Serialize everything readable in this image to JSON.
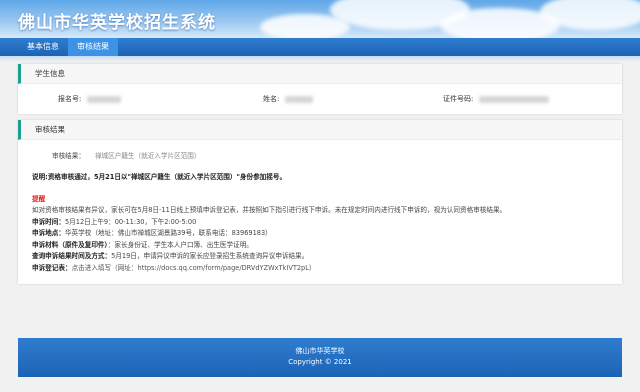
{
  "header": {
    "title": "佛山市华英学校招生系统"
  },
  "nav": {
    "tabs": [
      {
        "label": "基本信息",
        "active": false
      },
      {
        "label": "审核结果",
        "active": true
      }
    ]
  },
  "student_info": {
    "heading": "学生信息",
    "fields": [
      {
        "label": "报名号:"
      },
      {
        "label": "姓名:"
      },
      {
        "label": "证件号码:"
      }
    ]
  },
  "review": {
    "heading": "审核结果",
    "result_label": "审核结果：",
    "result_value": "禅城区户籍生（就近入学片区范围）",
    "explanation": "说明:资格审核通过，5月21日以\"禅城区户籍生（就近入学片区范围）\"身份参加摇号。",
    "reminder_title": "提醒",
    "reminder_text": "如对资格审核结果有异议，家长可在5月8日-11日线上预填申诉登记表，并按照如下指引进行线下申诉。未在规定时间内进行线下申诉的，视为认同资格审核结果。",
    "appeal_time_label": "申诉时间：",
    "appeal_time_value": "5月12日上午9：00-11:30，下午2:00-5:00",
    "appeal_place_label": "申诉地点：",
    "appeal_place_value": "华英学校（地址：佛山市禅城区湖景路39号，联系电话：83969183）",
    "appeal_materials_label": "申诉材料（原件及复印件）",
    "appeal_materials_value": "：家长身份证、学生本人户口簿、出生医学证明。",
    "query_label": "查询申诉结果时间及方式：",
    "query_value": "5月19日，申请异议申诉的家长应登录招生系统查询异议申诉结果。",
    "register_label": "申诉登记表：",
    "register_value": "点击进入填写（网址：https://docs.qq.com/form/page/DRVdYZWxTkIVT2pL）"
  },
  "footer": {
    "line1": "佛山市华英学校",
    "line2": "Copyright © 2021"
  },
  "colors": {
    "nav_blue": "#1c63b5",
    "accent_teal": "#1aa08d",
    "reminder_red": "#e02424"
  }
}
